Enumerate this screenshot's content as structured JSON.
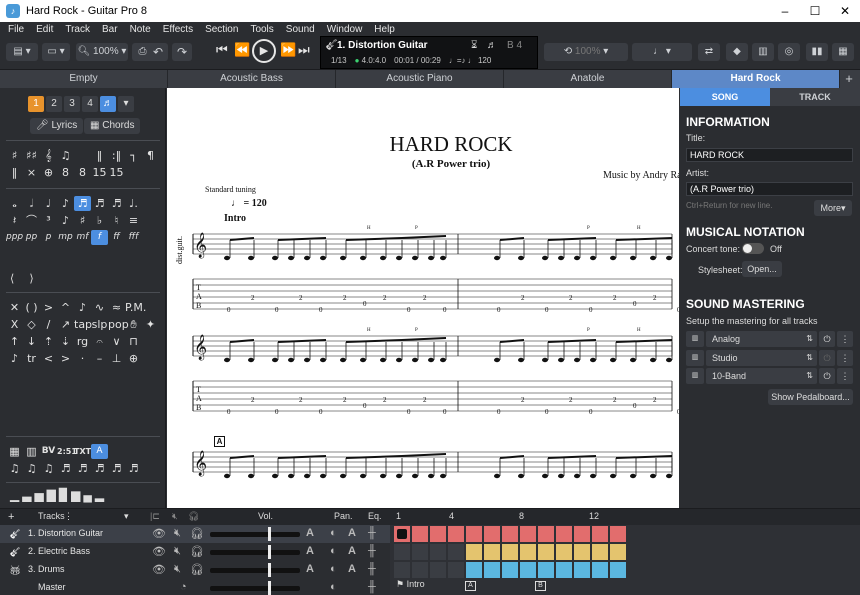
{
  "window": {
    "title": "Hard Rock - Guitar Pro 8",
    "min": "–",
    "max": "☐",
    "close": "✕"
  },
  "menu": [
    "File",
    "Edit",
    "Track",
    "Bar",
    "Note",
    "Effects",
    "Section",
    "Tools",
    "Sound",
    "Window",
    "Help"
  ],
  "toolbar": {
    "zoom": "100%",
    "undo": "↶",
    "redo": "↷",
    "lcd": {
      "track": "1. Distortion Guitar",
      "bar": "1/13",
      "signature": "4.0:4.0",
      "time": "00:01 / 00:29",
      "tempo": "120",
      "rel_tempo": "100%",
      "key": "B 4"
    }
  },
  "doc_tabs": [
    "Empty",
    "Acoustic Bass",
    "Acoustic Piano",
    "Anatole",
    "Hard Rock"
  ],
  "doc_tab_add": "+",
  "left_panel": {
    "voices": [
      "1",
      "2",
      "3",
      "4"
    ],
    "lyrics": "Lyrics",
    "chords": "Chords"
  },
  "score": {
    "title": "HARD ROCK",
    "subtitle": "(A.R Power trio)",
    "music_by": "Music by Andry Ra",
    "tuning": "Standard tuning",
    "tempo": "♩ = 120",
    "section_intro": "Intro",
    "track_label": "dist.guit.",
    "section_a": "A"
  },
  "right_panel": {
    "tabs": [
      "SONG",
      "TRACK"
    ],
    "information": "INFORMATION",
    "title_label": "Title:",
    "title_value": "HARD ROCK",
    "artist_label": "Artist:",
    "artist_value": "(A.R Power trio)",
    "hint": "Ctrl+Return for new line.",
    "more": "More▾",
    "notation": "MUSICAL NOTATION",
    "concert_tone": "Concert tone:",
    "concert_state": "Off",
    "stylesheet": "Stylesheet:",
    "open": "Open...",
    "mastering": "SOUND MASTERING",
    "mastering_hint": "Setup the mastering for all tracks",
    "chain": [
      "Analog",
      "Studio",
      "10-Band"
    ],
    "pedalboard": "Show Pedalboard..."
  },
  "tracks": {
    "header": "Tracks",
    "vol": "Vol.",
    "pan": "Pan.",
    "eq": "Eq.",
    "list": [
      {
        "name": "1. Distortion Guitar",
        "color": "#e26d6d"
      },
      {
        "name": "2. Electric Bass",
        "color": "#e4c46e"
      },
      {
        "name": "3. Drums",
        "color": "#5bb7e0"
      }
    ],
    "master": "Master",
    "ruler": [
      "1",
      "4",
      "8",
      "12"
    ],
    "sections": [
      {
        "mark": "",
        "label": "Intro"
      },
      {
        "mark": "A",
        "label": ""
      },
      {
        "mark": "B",
        "label": ""
      }
    ]
  }
}
